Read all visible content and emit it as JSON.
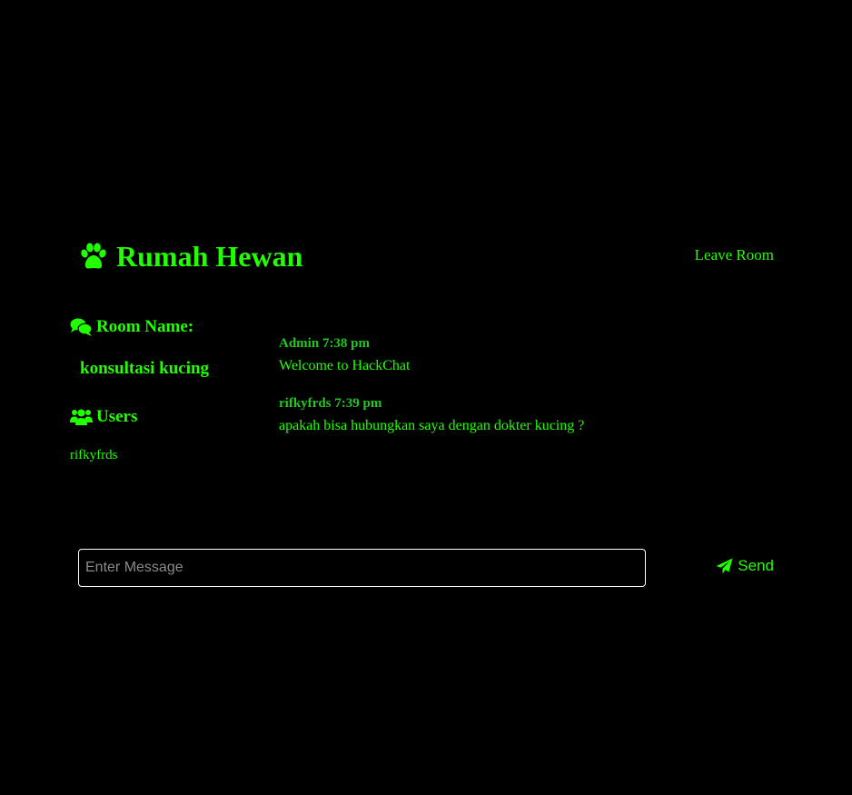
{
  "app": {
    "title": "Rumah Hewan",
    "brand_icon": "paw-icon",
    "leave_label": "Leave Room"
  },
  "colors": {
    "background": "#000000",
    "accent": "#22ff00",
    "meta": "#1fc91f",
    "input_border": "#ffffff",
    "placeholder": "#8a8a8a"
  },
  "sidebar": {
    "room_heading": "Room Name:",
    "room_icon": "comments-icon",
    "room_name": "konsultasi kucing",
    "users_heading": "Users",
    "users_icon": "users-icon",
    "users": [
      "rifkyfrds"
    ]
  },
  "messages": [
    {
      "author": "Admin",
      "time": "7:38 pm",
      "text": "Welcome to HackChat"
    },
    {
      "author": "rifkyfrds",
      "time": "7:39 pm",
      "text": "apakah bisa hubungkan saya dengan dokter kucing ?"
    }
  ],
  "composer": {
    "placeholder": "Enter Message",
    "value": "",
    "send_label": "Send",
    "send_icon": "paper-plane-icon"
  }
}
